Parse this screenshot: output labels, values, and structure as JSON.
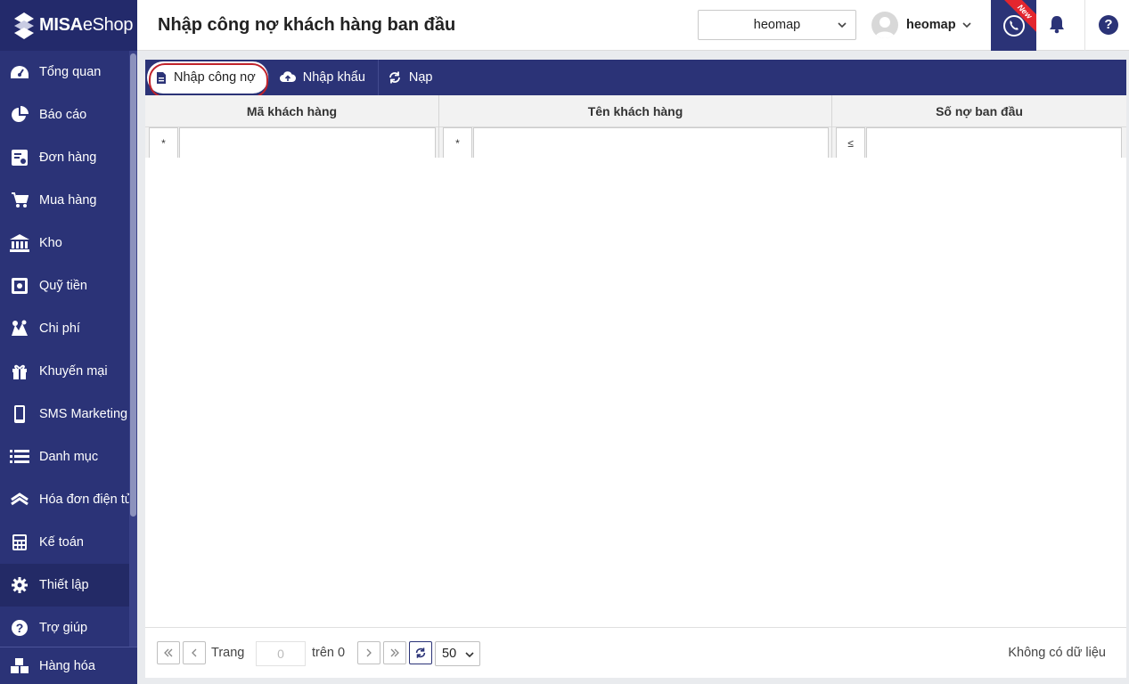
{
  "logo": {
    "brand": "MISA",
    "product": "eShop"
  },
  "sidebar": {
    "items": [
      {
        "label": "Tổng quan",
        "icon": "dashboard-icon"
      },
      {
        "label": "Báo cáo",
        "icon": "pie-chart-icon"
      },
      {
        "label": "Đơn hàng",
        "icon": "order-icon"
      },
      {
        "label": "Mua hàng",
        "icon": "cart-icon"
      },
      {
        "label": "Kho",
        "icon": "warehouse-icon"
      },
      {
        "label": "Quỹ tiền",
        "icon": "safe-icon"
      },
      {
        "label": "Chi phí",
        "icon": "expense-icon"
      },
      {
        "label": "Khuyến mại",
        "icon": "gift-icon"
      },
      {
        "label": "SMS Marketing",
        "icon": "phone-device-icon"
      },
      {
        "label": "Danh mục",
        "icon": "list-icon"
      },
      {
        "label": "Hóa đơn điện tử",
        "icon": "invoice-icon"
      },
      {
        "label": "Kế toán",
        "icon": "calculator-icon"
      },
      {
        "label": "Thiết lập",
        "icon": "gear-icon",
        "active": true
      },
      {
        "label": "Trợ giúp",
        "icon": "help-icon"
      }
    ],
    "bottom": {
      "label": "Hàng hóa",
      "icon": "goods-icon"
    }
  },
  "header": {
    "title": "Nhập công nợ khách hàng ban đầu",
    "store": "heomap",
    "user": "heomap",
    "new_badge": "New"
  },
  "toolbar": {
    "import_debt": "Nhập công nợ",
    "import_file": "Nhập khẩu",
    "reload": "Nạp"
  },
  "grid": {
    "columns": [
      {
        "label": "Mã khách hàng",
        "filter_op": "*"
      },
      {
        "label": "Tên khách hàng",
        "filter_op": "*"
      },
      {
        "label": "Số nợ ban đầu",
        "filter_op": "≤"
      }
    ]
  },
  "pager": {
    "page_label": "Trang",
    "page_value": "0",
    "of_label": "trên 0",
    "page_size": "50",
    "empty_text": "Không có dữ liệu"
  },
  "colors": {
    "primary": "#2b3377",
    "highlight": "#c0232b",
    "new_badge": "#e3262e"
  }
}
